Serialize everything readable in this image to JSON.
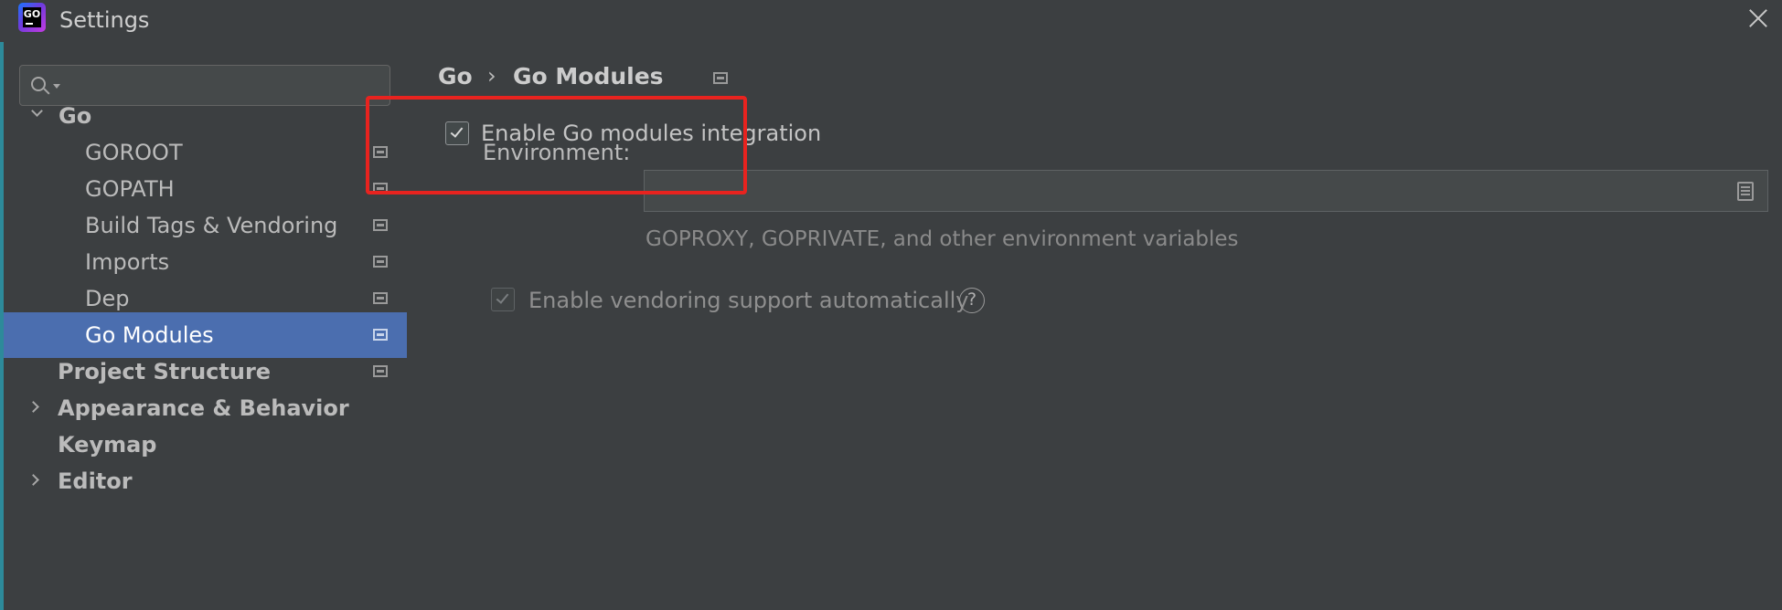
{
  "window": {
    "title": "Settings",
    "app_icon": "goland-logo-icon",
    "app_icon_text": "GO",
    "close_icon": "close-icon"
  },
  "colors": {
    "background": "#3c3f41",
    "selection": "#4b6eaf",
    "highlight_box": "#e8231f"
  },
  "sidebar": {
    "search": {
      "value": "",
      "placeholder": "",
      "icon": "search-icon"
    },
    "items": [
      {
        "label": "Go",
        "level": 0,
        "bold": true,
        "expanded": true,
        "selected": false,
        "project_icon": false
      },
      {
        "label": "GOROOT",
        "level": 1,
        "bold": false,
        "selected": false,
        "project_icon": true
      },
      {
        "label": "GOPATH",
        "level": 1,
        "bold": false,
        "selected": false,
        "project_icon": true
      },
      {
        "label": "Build Tags & Vendoring",
        "level": 1,
        "bold": false,
        "selected": false,
        "project_icon": true
      },
      {
        "label": "Imports",
        "level": 1,
        "bold": false,
        "selected": false,
        "project_icon": true
      },
      {
        "label": "Dep",
        "level": 1,
        "bold": false,
        "selected": false,
        "project_icon": true
      },
      {
        "label": "Go Modules",
        "level": 1,
        "bold": false,
        "selected": true,
        "project_icon": true
      },
      {
        "label": "Project Structure",
        "level": 0,
        "bold": true,
        "selected": false,
        "project_icon": true
      },
      {
        "label": "Appearance & Behavior",
        "level": 0,
        "bold": true,
        "expanded": false,
        "selected": false,
        "project_icon": false
      },
      {
        "label": "Keymap",
        "level": 0,
        "bold": true,
        "selected": false,
        "project_icon": false
      },
      {
        "label": "Editor",
        "level": 0,
        "bold": true,
        "expanded": false,
        "selected": false,
        "project_icon": false
      }
    ]
  },
  "content": {
    "breadcrumb": {
      "parent": "Go",
      "separator": "›",
      "current": "Go Modules",
      "icon": "project-level-icon"
    },
    "enable_modules": {
      "label": "Enable Go modules integration",
      "checked": true
    },
    "environment": {
      "label": "Environment:",
      "value": "",
      "hint": "GOPROXY, GOPRIVATE, and other environment variables",
      "icon": "browse-document-icon"
    },
    "enable_vendoring": {
      "label": "Enable vendoring support automatically",
      "checked": true,
      "enabled": false,
      "help_icon": "help-icon",
      "help_text": "?"
    }
  }
}
